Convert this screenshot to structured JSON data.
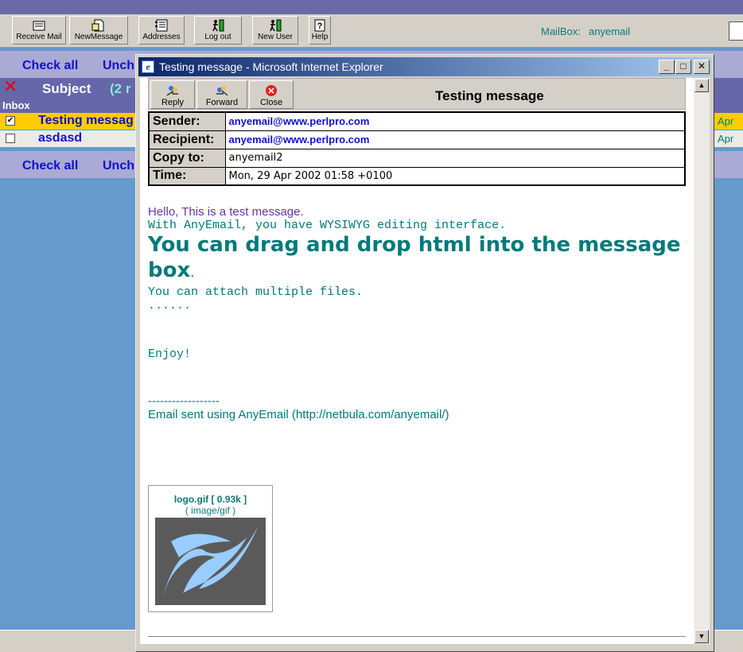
{
  "toolbar": {
    "receive": "Receive Mail",
    "new_message": "NewMessage",
    "addresses": "Addresses",
    "logout": "Log out",
    "new_user": "New User",
    "help": "Help"
  },
  "mailbox": {
    "label": "MailBox:",
    "value": "anyemail"
  },
  "list": {
    "check_all": "Check all",
    "uncheck_all": "Unch",
    "subject_header": "Subject",
    "subject_count": "(2 r",
    "folder": "Inbox",
    "rows": [
      {
        "subject": "Testing messag",
        "date": "Apr",
        "checked": true
      },
      {
        "subject": "asdasd",
        "date": "Apr",
        "checked": false
      }
    ]
  },
  "popup": {
    "window_title": "Testing message - Microsoft Internet Explorer",
    "buttons": {
      "reply": "Reply",
      "forward": "Forward",
      "close": "Close"
    },
    "message_title": "Testing message",
    "headers": {
      "sender_label": "Sender:",
      "sender": "anyemail@www.perlpro.com",
      "recipient_label": "Recipient:",
      "recipient": "anyemail@www.perlpro.com",
      "copy_label": "Copy to:",
      "copy": "anyemail2",
      "time_label": "Time:",
      "time": "Mon, 29 Apr 2002 01:58 +0100"
    },
    "body": {
      "hello": "Hello,  This is a test message.",
      "line2": "With AnyEmail, you have WYSIWYG editing interface.",
      "big": "You can drag and drop html into the message box",
      "big_dot": ".",
      "line4": "You can attach multiple files.",
      "dots": "......",
      "enjoy": "Enjoy!",
      "sig_line": "------------------",
      "sig": "Email sent using AnyEmail (http://netbula.com/anyemail/)"
    },
    "attachment": {
      "name": "logo.gif [ 0.93k ]",
      "type": "( image/gif )"
    }
  },
  "colors": {
    "accent": "#0a246a",
    "link": "#1010d0",
    "teal": "#007a7a",
    "selected_row": "#ffcc00"
  }
}
